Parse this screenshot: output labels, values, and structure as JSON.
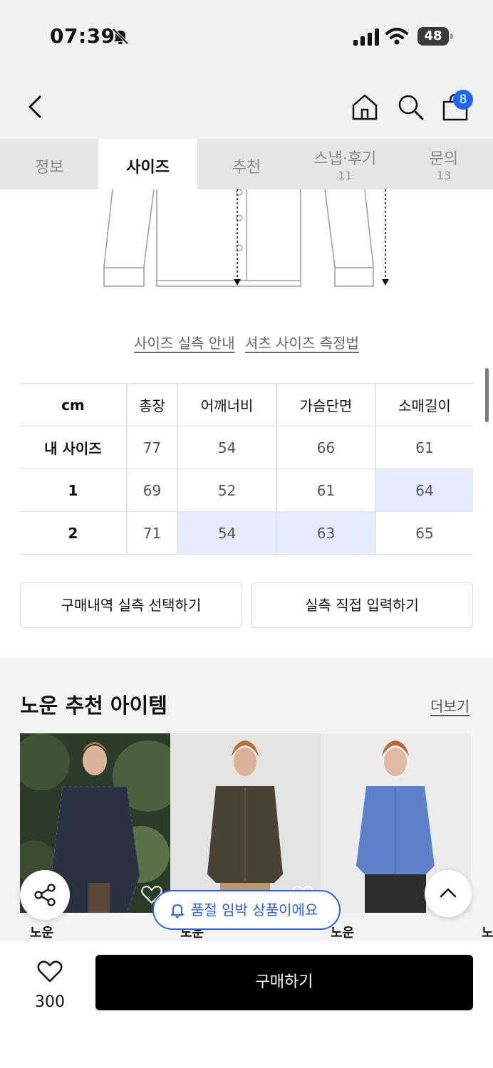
{
  "status": {
    "time": "07:39",
    "battery": "48"
  },
  "nav": {
    "cart_count": "8"
  },
  "tabs": [
    {
      "label": "정보",
      "count": ""
    },
    {
      "label": "사이즈",
      "count": ""
    },
    {
      "label": "추천",
      "count": ""
    },
    {
      "label": "스냅·후기",
      "count": "11"
    },
    {
      "label": "문의",
      "count": "13"
    }
  ],
  "guides": {
    "actual_size": "사이즈 실측 안내",
    "shirt_measure": "셔츠 사이즈 측정법"
  },
  "size_table": {
    "headers": [
      "cm",
      "총장",
      "어깨너비",
      "가슴단면",
      "소매길이"
    ],
    "rows": [
      {
        "label": "내 사이즈",
        "values": [
          "77",
          "54",
          "66",
          "61"
        ]
      },
      {
        "label": "1",
        "values": [
          "69",
          "52",
          "61",
          "64"
        ]
      },
      {
        "label": "2",
        "values": [
          "71",
          "54",
          "63",
          "65"
        ]
      }
    ]
  },
  "actions": {
    "purchase_history": "구매내역 실측 선택하기",
    "manual_input": "실측 직접 입력하기"
  },
  "recommend": {
    "title": "노운 추천 아이템",
    "more": "더보기",
    "brands": [
      "노운",
      "노운",
      "노운",
      "노"
    ]
  },
  "soldout_notice": "품절 임박 상품이에요",
  "bottom": {
    "like_count": "300",
    "buy_label": "구매하기"
  },
  "colors": {
    "accent": "#1e66f5",
    "highlight": "#e5ecfd",
    "buy": "#000000"
  }
}
